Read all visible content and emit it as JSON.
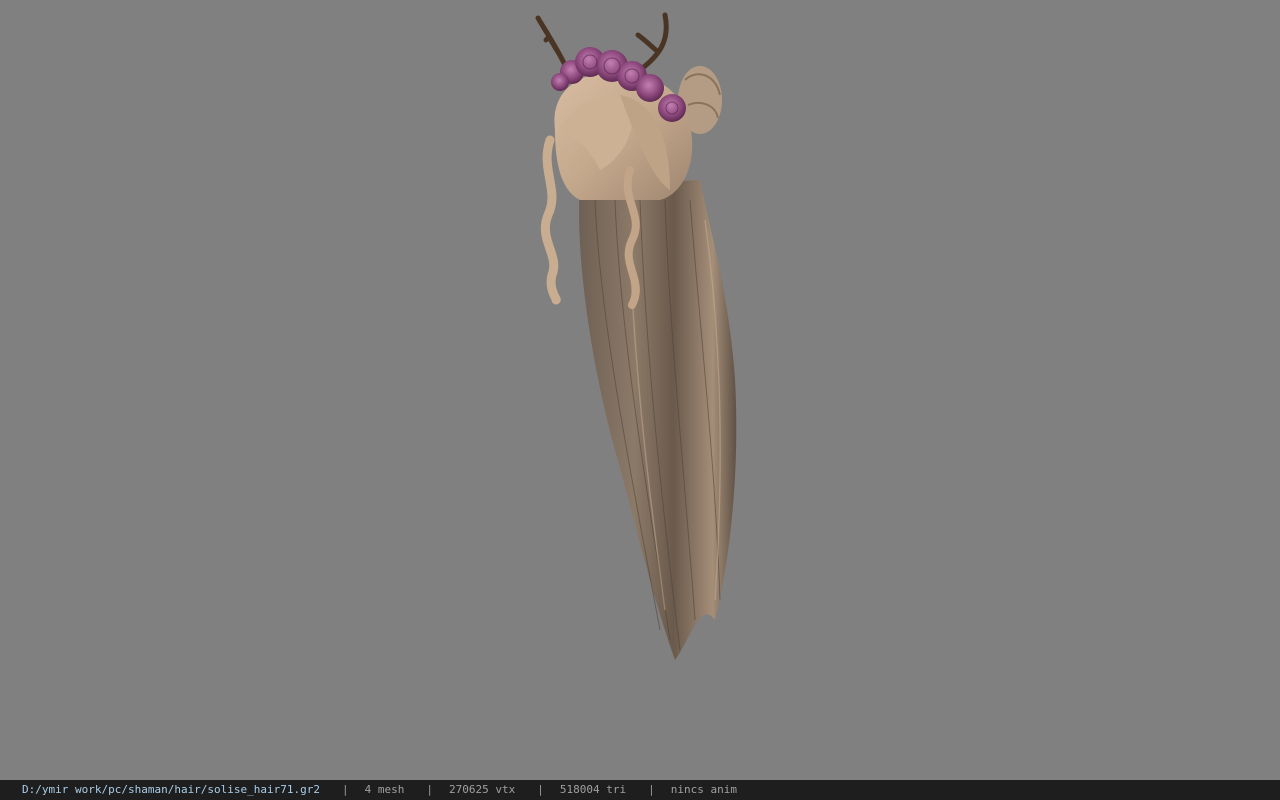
{
  "viewport": {
    "background": "#808080",
    "model": {
      "description_icon": "hair-model-icon"
    }
  },
  "statusbar": {
    "file_path": "D:/ymir work/pc/shaman/hair/solise_hair71.gr2",
    "separator": "|",
    "mesh_count": "4 mesh",
    "vertex_count": "270625 vtx",
    "triangle_count": "518004 tri",
    "anim_status": "nincs anim"
  }
}
